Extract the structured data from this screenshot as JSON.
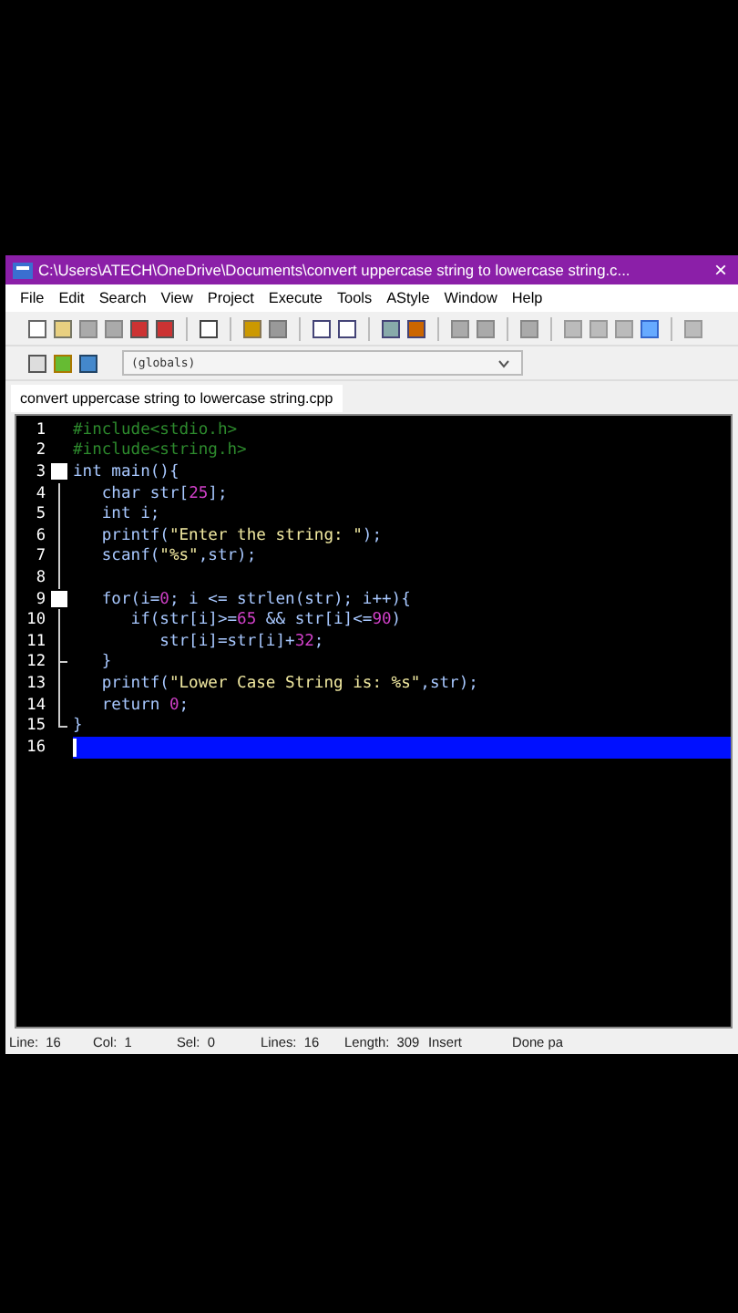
{
  "window": {
    "title": "C:\\Users\\ATECH\\OneDrive\\Documents\\convert uppercase string to lowercase string.c...",
    "close": "×"
  },
  "menu": [
    "File",
    "Edit",
    "Search",
    "View",
    "Project",
    "Execute",
    "Tools",
    "AStyle",
    "Window",
    "Help"
  ],
  "scope": {
    "value": "(globals)"
  },
  "tabs": [
    {
      "label": "convert uppercase string to lowercase string.cpp",
      "selected": true
    }
  ],
  "lines": [
    {
      "number": "1",
      "kind": "plain",
      "selected": false,
      "tokens": [
        {
          "kind": "pre",
          "text": "#include<stdio.h>"
        }
      ]
    },
    {
      "number": "2",
      "kind": "plain",
      "selected": false,
      "tokens": [
        {
          "kind": "pre",
          "text": "#include<string.h>"
        }
      ]
    },
    {
      "number": "3",
      "kind": "foldstart",
      "selected": false,
      "tokens": [
        {
          "kind": "code",
          "text": "int main(){"
        }
      ]
    },
    {
      "number": "4",
      "kind": "foldbody",
      "selected": false,
      "tokens": [
        {
          "kind": "code",
          "text": "   char str["
        },
        {
          "kind": "num",
          "text": "25"
        },
        {
          "kind": "code",
          "text": "];"
        }
      ]
    },
    {
      "number": "5",
      "kind": "foldbody",
      "selected": false,
      "tokens": [
        {
          "kind": "code",
          "text": "   int i;"
        }
      ]
    },
    {
      "number": "6",
      "kind": "foldbody",
      "selected": false,
      "tokens": [
        {
          "kind": "code",
          "text": "   printf("
        },
        {
          "kind": "str",
          "text": "\"Enter the string: \""
        },
        {
          "kind": "code",
          "text": ");"
        }
      ]
    },
    {
      "number": "7",
      "kind": "foldbody",
      "selected": false,
      "tokens": [
        {
          "kind": "code",
          "text": "   scanf("
        },
        {
          "kind": "str",
          "text": "\"%s\""
        },
        {
          "kind": "code",
          "text": ",str);"
        }
      ]
    },
    {
      "number": "8",
      "kind": "foldbody",
      "selected": false
    },
    {
      "number": "9",
      "kind": "foldstart",
      "selected": false,
      "tokens": [
        {
          "kind": "code",
          "text": "   for(i="
        },
        {
          "kind": "num",
          "text": "0"
        },
        {
          "kind": "code",
          "text": "; i <= strlen(str); i++){"
        }
      ]
    },
    {
      "number": "10",
      "kind": "foldbody",
      "selected": false,
      "tokens": [
        {
          "kind": "code",
          "text": "      if(str[i]>="
        },
        {
          "kind": "num",
          "text": "65"
        },
        {
          "kind": "code",
          "text": " && str[i]<="
        },
        {
          "kind": "num",
          "text": "90"
        },
        {
          "kind": "code",
          "text": ")"
        }
      ]
    },
    {
      "number": "11",
      "kind": "foldbody",
      "selected": false,
      "tokens": [
        {
          "kind": "code",
          "text": "         str[i]=str[i]+"
        },
        {
          "kind": "num",
          "text": "32"
        },
        {
          "kind": "code",
          "text": ";"
        }
      ]
    },
    {
      "number": "12",
      "kind": "foldbranch",
      "selected": false,
      "tokens": [
        {
          "kind": "code",
          "text": "   }"
        }
      ]
    },
    {
      "number": "13",
      "kind": "foldbody",
      "selected": false,
      "tokens": [
        {
          "kind": "code",
          "text": "   printf("
        },
        {
          "kind": "str",
          "text": "\"Lower Case String is: %s\""
        },
        {
          "kind": "code",
          "text": ",str);"
        }
      ]
    },
    {
      "number": "14",
      "kind": "foldbody",
      "selected": false,
      "tokens": [
        {
          "kind": "code",
          "text": "   return "
        },
        {
          "kind": "num",
          "text": "0"
        },
        {
          "kind": "code",
          "text": ";"
        }
      ]
    },
    {
      "number": "15",
      "kind": "foldend",
      "selected": false,
      "tokens": [
        {
          "kind": "code",
          "text": "}"
        }
      ]
    },
    {
      "number": "16",
      "kind": "plain",
      "selected": true
    }
  ],
  "status_bar": [
    {
      "label": "Line:",
      "value": "16"
    },
    {
      "label": "Col:",
      "value": "1"
    },
    {
      "label": "Sel:",
      "value": "0"
    },
    {
      "label": "Lines:",
      "value": "16"
    },
    {
      "label": "Length:",
      "value": "309"
    },
    {
      "value": "Insert"
    },
    {
      "value": "Done pa"
    }
  ]
}
